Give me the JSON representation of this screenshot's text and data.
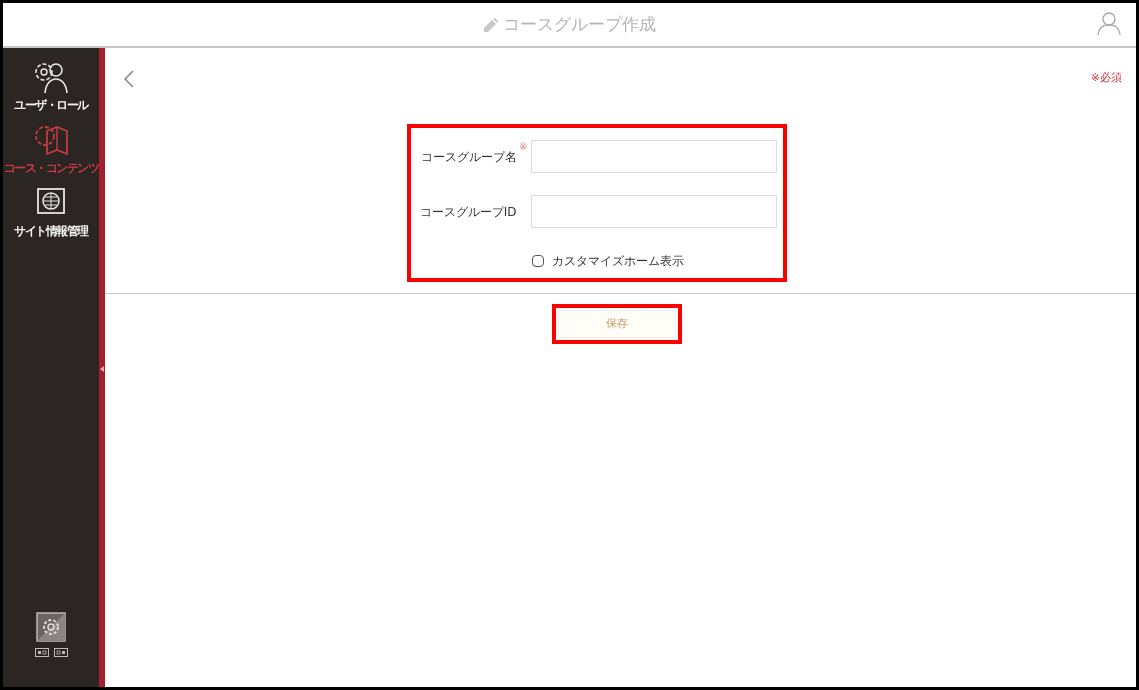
{
  "header": {
    "title": "コースグループ作成"
  },
  "sidebar": {
    "items": [
      {
        "label": "ユーザ・ロール",
        "selected": false
      },
      {
        "label": "コース・コンテンツ",
        "selected": true
      },
      {
        "label": "サイト情報管理",
        "selected": false
      }
    ]
  },
  "required_note": "※必須",
  "form": {
    "fields": [
      {
        "label": "コースグループ名",
        "required_mark": "※"
      },
      {
        "label": "コースグループID"
      }
    ],
    "checkbox": {
      "label": "カスタマイズホーム表示",
      "checked": false
    }
  },
  "save_button": "保存"
}
